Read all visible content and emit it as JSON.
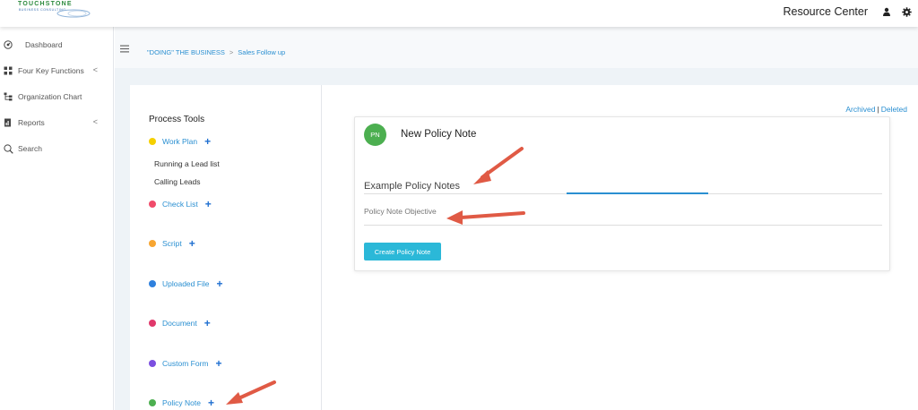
{
  "header": {
    "logo_text": "TOUCHSTONE",
    "logo_subtext": "BUSINESS CONSULTING",
    "resource_center_label": "Resource Center",
    "user_icon": "user-icon",
    "settings_icon": "gear-icon"
  },
  "sidebar": {
    "items": [
      {
        "label": "Dashboard",
        "icon": "dashboard-icon"
      },
      {
        "label": "Four Key Functions",
        "icon": "functions-icon",
        "chevron": "<"
      },
      {
        "label": "Organization Chart",
        "icon": "org-chart-icon"
      },
      {
        "label": "Reports",
        "icon": "reports-icon",
        "chevron": "<"
      },
      {
        "label": "Search",
        "icon": "search-icon"
      }
    ]
  },
  "breadcrumb": {
    "parent": "\"DOING\" THE BUSINESS",
    "separator": ">",
    "current": "Sales Follow up"
  },
  "tools": {
    "title": "Process Tools",
    "items": [
      {
        "label": "Work Plan",
        "color": "#f5d000",
        "plus": "+"
      },
      {
        "label": "Check List",
        "color": "#f04b6a",
        "plus": "+"
      },
      {
        "label": "Script",
        "color": "#f7a531",
        "plus": "+"
      },
      {
        "label": "Uploaded File",
        "color": "#2f80dd",
        "plus": "+"
      },
      {
        "label": "Document",
        "color": "#e0386b",
        "plus": "+"
      },
      {
        "label": "Custom Form",
        "color": "#7b4fe0",
        "plus": "+"
      },
      {
        "label": "Policy Note",
        "color": "#4caf50",
        "plus": "+"
      }
    ],
    "work_plan_subitems": [
      "Running a Lead list",
      "Calling Leads"
    ]
  },
  "links": {
    "archived": "Archived",
    "separator": "|",
    "deleted": "Deleted"
  },
  "form": {
    "avatar_initials": "PN",
    "title": "New Policy Note",
    "name_value": "Example Policy Notes",
    "objective_placeholder": "Policy Note Objective",
    "create_button": "Create Policy Note"
  },
  "colors": {
    "accent": "#2a8fd1",
    "button": "#2bb8d8",
    "avatar": "#4caf50",
    "annotation_arrow": "#e05a45"
  }
}
